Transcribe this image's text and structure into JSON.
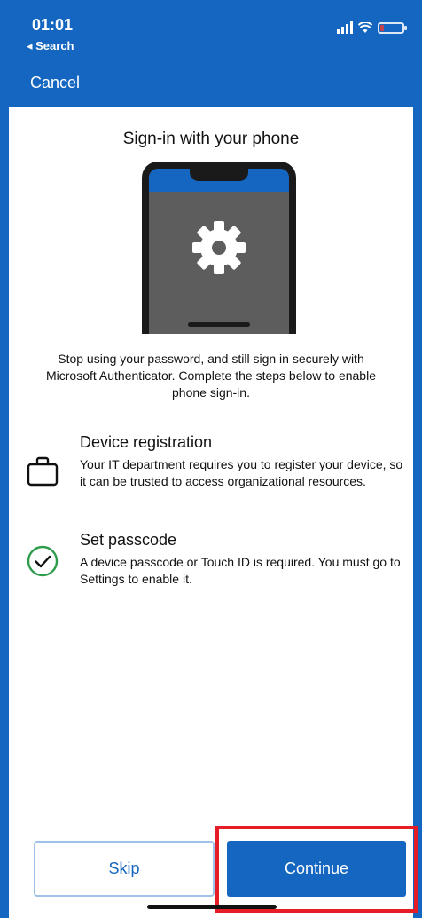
{
  "status_bar": {
    "time": "01:01",
    "back_label": "◂ Search"
  },
  "nav": {
    "cancel_label": "Cancel"
  },
  "main": {
    "title": "Sign-in with your phone",
    "description": "Stop using your password, and still sign in securely with Microsoft Authenticator. Complete the steps below to enable phone sign-in.",
    "steps": [
      {
        "title": "Device registration",
        "text": "Your IT department requires you to register your device, so it can be trusted to access organizational resources.",
        "icon": "briefcase-icon",
        "status": "pending"
      },
      {
        "title": "Set passcode",
        "text": "A device passcode or Touch ID is required. You must go to Settings to enable it.",
        "icon": "check-circle-icon",
        "status": "completed"
      }
    ]
  },
  "buttons": {
    "skip_label": "Skip",
    "continue_label": "Continue"
  },
  "colors": {
    "brand_blue": "#1466c0",
    "highlight_red": "#e51d26",
    "success_green": "#2e9d4b"
  }
}
